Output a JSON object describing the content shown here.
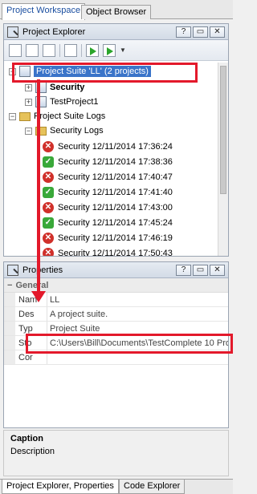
{
  "tabs_top": [
    "Project Workspace",
    "Object Browser"
  ],
  "explorer": {
    "title": "Project Explorer",
    "buttons": [
      "?",
      "▭",
      "✕"
    ],
    "tree": {
      "root": "Project Suite 'LL' (2 projects)",
      "items": [
        {
          "label": "Security",
          "bold": true
        },
        {
          "label": "TestProject1",
          "bold": false
        },
        {
          "label": "Project Suite Logs",
          "bold": false
        },
        {
          "label": "Security Logs",
          "bold": false
        }
      ],
      "logs": [
        {
          "status": "error",
          "label": "Security 12/11/2014 17:36:24"
        },
        {
          "status": "ok",
          "label": "Security 12/11/2014 17:38:36"
        },
        {
          "status": "error",
          "label": "Security 12/11/2014 17:40:47"
        },
        {
          "status": "ok",
          "label": "Security 12/11/2014 17:41:40"
        },
        {
          "status": "error",
          "label": "Security 12/11/2014 17:43:00"
        },
        {
          "status": "ok",
          "label": "Security 12/11/2014 17:45:24"
        },
        {
          "status": "error",
          "label": "Security 12/11/2014 17:46:19"
        },
        {
          "status": "error",
          "label": "Security 12/11/2014 17:50:43"
        }
      ]
    }
  },
  "properties": {
    "title": "Properties",
    "buttons": [
      "?",
      "▭",
      "✕"
    ],
    "group": "General",
    "rows": [
      {
        "name": "Nam",
        "value": "LL"
      },
      {
        "name": "Des",
        "value": "A project suite."
      },
      {
        "name": "Typ",
        "value": "Project Suite"
      },
      {
        "name": "Sto",
        "value": "C:\\Users\\Bill\\Documents\\TestComplete 10 Pro"
      },
      {
        "name": "Cor",
        "value": ""
      }
    ]
  },
  "caption": {
    "title": "Caption",
    "text": "Description"
  },
  "tabs_bottom": [
    "Project Explorer, Properties",
    "Code Explorer"
  ],
  "colors": {
    "highlight": "#e3192b",
    "selection": "#3a74c9",
    "error": "#d0302a",
    "ok": "#39a839"
  }
}
